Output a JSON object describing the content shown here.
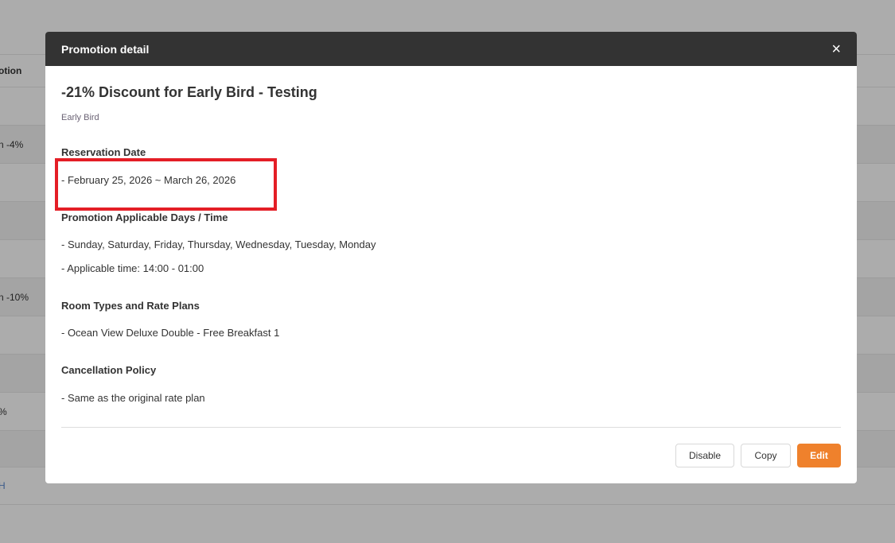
{
  "background": {
    "header": "otion",
    "rows": [
      "n -4%",
      "n -10%",
      "%",
      "H"
    ]
  },
  "modal": {
    "title": "Promotion detail",
    "promo_name": "-21% Discount for Early Bird - Testing",
    "category": "Early Bird",
    "sections": [
      {
        "heading": "Reservation Date",
        "lines": [
          "- February 25, 2026 ~ March 26, 2026"
        ]
      },
      {
        "heading": "Promotion Applicable Days / Time",
        "lines": [
          "- Sunday, Saturday, Friday, Thursday, Wednesday, Tuesday, Monday",
          "- Applicable time: 14:00 - 01:00"
        ]
      },
      {
        "heading": "Room Types and Rate Plans",
        "lines": [
          "- Ocean View Deluxe Double - Free Breakfast 1"
        ]
      },
      {
        "heading": "Cancellation Policy",
        "lines": [
          "- Same as the original rate plan"
        ]
      }
    ],
    "buttons": {
      "disable": "Disable",
      "copy": "Copy",
      "edit": "Edit"
    },
    "close_icon": "×"
  },
  "colors": {
    "accent": "#ef812c",
    "highlight": "#e41e26",
    "header": "#333333"
  }
}
